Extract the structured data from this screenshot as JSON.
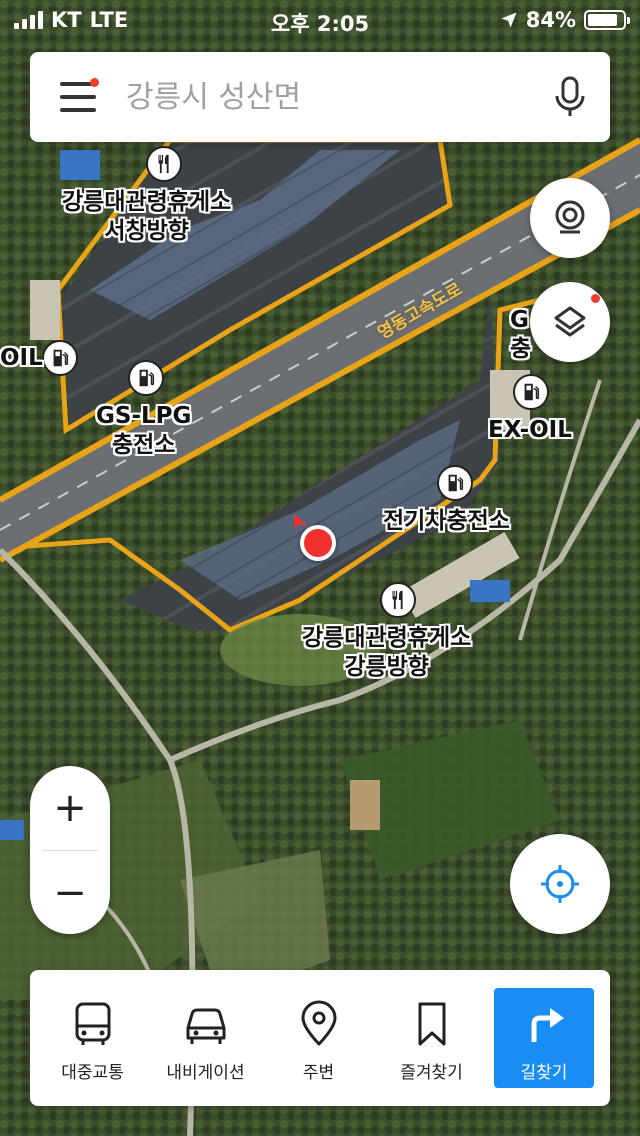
{
  "status_bar": {
    "carrier": "KT",
    "network": "LTE",
    "time": "오후 2:05",
    "battery_text": "84%",
    "battery_level": 0.84
  },
  "search": {
    "placeholder": "강릉시 성산면"
  },
  "map": {
    "road_label": "영동고속도로",
    "pois": [
      {
        "line1": "강릉대관령휴게소",
        "line2": "서창방향",
        "icon": "restaurant-icon"
      },
      {
        "line1": "GS-LPG",
        "line2": "충전소",
        "icon": "gas-station-icon"
      },
      {
        "line1": "EX-OIL",
        "line2": "",
        "icon": "gas-station-icon"
      },
      {
        "line1": "전기차충전소",
        "line2": "",
        "icon": "gas-station-icon"
      },
      {
        "line1": "강릉대관령휴게소",
        "line2": "강릉방향",
        "icon": "restaurant-icon"
      },
      {
        "line1": "OIL",
        "line2": "",
        "icon": "gas-station-icon"
      },
      {
        "line1": "G",
        "line2": "충",
        "icon": "gas-station-icon"
      }
    ]
  },
  "zoom": {
    "in_label": "+",
    "out_label": "−"
  },
  "bottom_nav": {
    "items": [
      {
        "label": "대중교통",
        "icon": "bus-icon"
      },
      {
        "label": "내비게이션",
        "icon": "car-icon"
      },
      {
        "label": "주변",
        "icon": "location-pin-icon"
      },
      {
        "label": "즐겨찾기",
        "icon": "bookmark-icon"
      },
      {
        "label": "길찾기",
        "icon": "directions-arrow-icon"
      }
    ]
  },
  "colors": {
    "accent": "#1a8df5",
    "badge": "#f03d2a",
    "road": "#e8a317",
    "location_dot": "#f0302d"
  }
}
